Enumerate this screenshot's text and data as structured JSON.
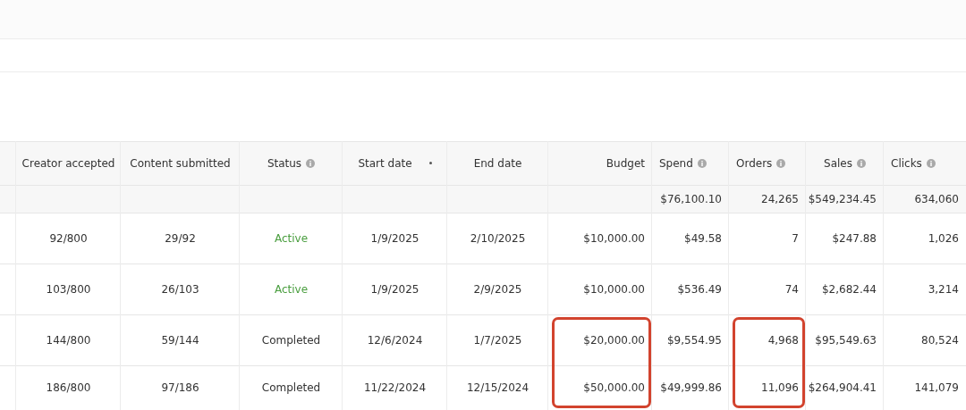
{
  "table": {
    "columns": [
      {
        "label": "Creator accepted",
        "info": false,
        "sort_indicator": false
      },
      {
        "label": "Content submitted",
        "info": false,
        "sort_indicator": false
      },
      {
        "label": "Status",
        "info": true,
        "sort_indicator": false
      },
      {
        "label": "Start date",
        "info": false,
        "sort_indicator": true
      },
      {
        "label": "End date",
        "info": false,
        "sort_indicator": false
      },
      {
        "label": "Budget",
        "info": false,
        "sort_indicator": false
      },
      {
        "label": "Spend",
        "info": true,
        "sort_indicator": false
      },
      {
        "label": "Orders",
        "info": true,
        "sort_indicator": false
      },
      {
        "label": "Sales",
        "info": true,
        "sort_indicator": false
      },
      {
        "label": "Clicks",
        "info": true,
        "sort_indicator": false
      }
    ],
    "summary": [
      "$76,100.10",
      "24,265",
      "$549,234.45",
      "634,060"
    ],
    "rows": [
      {
        "cells": [
          {
            "text": "92/800",
            "kind": "text",
            "highlighted": false
          },
          {
            "text": "29/92",
            "kind": "text",
            "highlighted": false
          },
          {
            "text": "Active",
            "kind": "active",
            "highlighted": false
          },
          {
            "text": "1/9/2025",
            "kind": "text",
            "highlighted": false
          },
          {
            "text": "2/10/2025",
            "kind": "text",
            "highlighted": false
          },
          {
            "text": "$10,000.00",
            "kind": "text",
            "highlighted": false
          },
          {
            "text": "$49.58",
            "kind": "text",
            "highlighted": false
          },
          {
            "text": "7",
            "kind": "text",
            "highlighted": false
          },
          {
            "text": "$247.88",
            "kind": "text",
            "highlighted": false
          },
          {
            "text": "1,026",
            "kind": "text",
            "highlighted": false
          }
        ]
      },
      {
        "cells": [
          {
            "text": "103/800",
            "kind": "text",
            "highlighted": false
          },
          {
            "text": "26/103",
            "kind": "text",
            "highlighted": false
          },
          {
            "text": "Active",
            "kind": "active",
            "highlighted": false
          },
          {
            "text": "1/9/2025",
            "kind": "text",
            "highlighted": false
          },
          {
            "text": "2/9/2025",
            "kind": "text",
            "highlighted": false
          },
          {
            "text": "$10,000.00",
            "kind": "text",
            "highlighted": false
          },
          {
            "text": "$536.49",
            "kind": "text",
            "highlighted": false
          },
          {
            "text": "74",
            "kind": "text",
            "highlighted": false
          },
          {
            "text": "$2,682.44",
            "kind": "text",
            "highlighted": false
          },
          {
            "text": "3,214",
            "kind": "text",
            "highlighted": false
          }
        ]
      },
      {
        "cells": [
          {
            "text": "144/800",
            "kind": "text",
            "highlighted": false
          },
          {
            "text": "59/144",
            "kind": "text",
            "highlighted": false
          },
          {
            "text": "Completed",
            "kind": "completed",
            "highlighted": false
          },
          {
            "text": "12/6/2024",
            "kind": "text",
            "highlighted": false
          },
          {
            "text": "1/7/2025",
            "kind": "text",
            "highlighted": false
          },
          {
            "text": "$20,000.00",
            "kind": "text",
            "highlighted": true
          },
          {
            "text": "$9,554.95",
            "kind": "text",
            "highlighted": false
          },
          {
            "text": "4,968",
            "kind": "text",
            "highlighted": true
          },
          {
            "text": "$95,549.63",
            "kind": "text",
            "highlighted": false
          },
          {
            "text": "80,524",
            "kind": "text",
            "highlighted": false
          }
        ]
      },
      {
        "cells": [
          {
            "text": "186/800",
            "kind": "text",
            "highlighted": false
          },
          {
            "text": "97/186",
            "kind": "text",
            "highlighted": false
          },
          {
            "text": "Completed",
            "kind": "completed",
            "highlighted": false
          },
          {
            "text": "11/22/2024",
            "kind": "text",
            "highlighted": false
          },
          {
            "text": "12/15/2024",
            "kind": "text",
            "highlighted": false
          },
          {
            "text": "$50,000.00",
            "kind": "text",
            "highlighted": true
          },
          {
            "text": "$49,999.86",
            "kind": "text",
            "highlighted": false
          },
          {
            "text": "11,096",
            "kind": "text",
            "highlighted": true
          },
          {
            "text": "$264,904.41",
            "kind": "text",
            "highlighted": false
          },
          {
            "text": "141,079",
            "kind": "text",
            "highlighted": false
          }
        ]
      }
    ]
  }
}
